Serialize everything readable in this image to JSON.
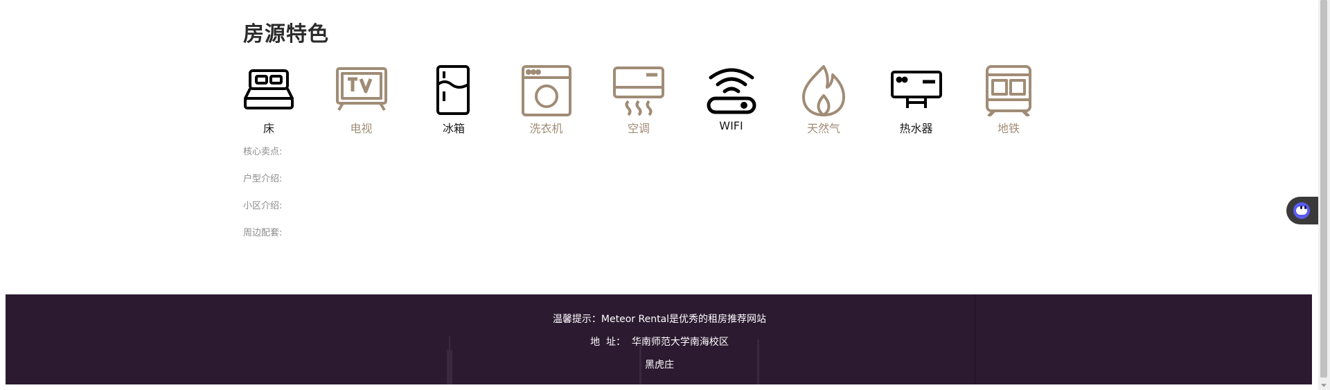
{
  "section": {
    "title": "房源特色"
  },
  "features": [
    {
      "label": "床",
      "icon": "bed-icon",
      "available": true
    },
    {
      "label": "电视",
      "icon": "tv-icon",
      "available": false
    },
    {
      "label": "冰箱",
      "icon": "fridge-icon",
      "available": true
    },
    {
      "label": "洗衣机",
      "icon": "washing-machine-icon",
      "available": false
    },
    {
      "label": "空调",
      "icon": "air-conditioner-icon",
      "available": false
    },
    {
      "label": "WIFI",
      "icon": "wifi-router-icon",
      "available": true
    },
    {
      "label": "天然气",
      "icon": "gas-flame-icon",
      "available": false
    },
    {
      "label": "热水器",
      "icon": "water-heater-icon",
      "available": true
    },
    {
      "label": "地铁",
      "icon": "subway-icon",
      "available": false
    }
  ],
  "info": {
    "core_selling_points": "核心卖点:",
    "layout_intro": "户型介绍:",
    "community_intro": "小区介绍:",
    "surroundings": "周边配套:"
  },
  "footer": {
    "tip": "温馨提示：Meteor Rental是优秀的租房推荐网站",
    "address": "地  址：  华南师范大学南海校区",
    "team": "黑虎庄"
  },
  "colors": {
    "available": "#000000",
    "unavailable": "#a08c76",
    "footer_bg": "#2c1a30",
    "chat_accent": "#5a5cf0"
  },
  "chat_widget": {
    "icon": "chat-bot-icon"
  }
}
